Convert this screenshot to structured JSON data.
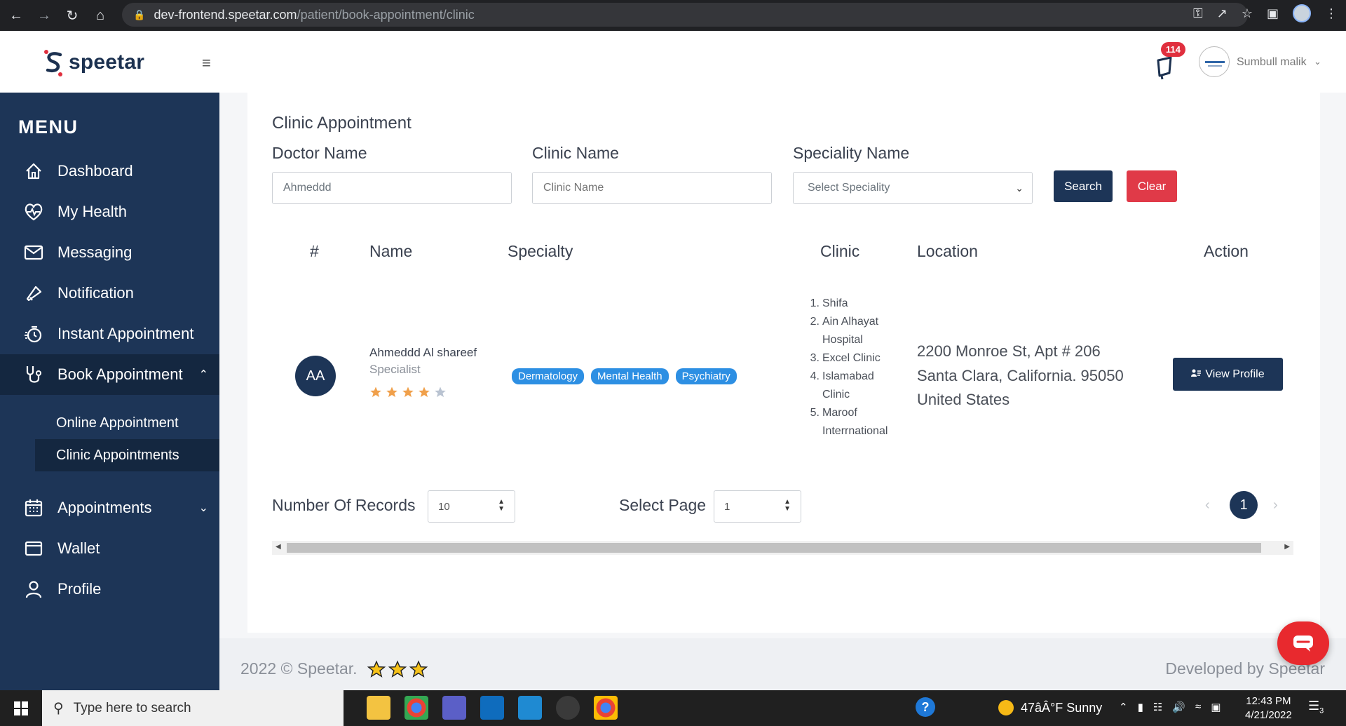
{
  "browser": {
    "url_host": "dev-frontend.speetar.com",
    "url_path": "/patient/book-appointment/clinic"
  },
  "header": {
    "logo_text": "speetar",
    "notification_count": "114",
    "user_name": "Sumbull malik"
  },
  "sidebar": {
    "menu_title": "MENU",
    "items": [
      {
        "label": "Dashboard",
        "icon": "home-icon"
      },
      {
        "label": "My Health",
        "icon": "heart-pulse-icon"
      },
      {
        "label": "Messaging",
        "icon": "envelope-icon"
      },
      {
        "label": "Notification",
        "icon": "megaphone-icon"
      },
      {
        "label": "Instant Appointment",
        "icon": "timer-icon"
      },
      {
        "label": "Book Appointment",
        "icon": "stethoscope-icon"
      },
      {
        "label": "Appointments",
        "icon": "calendar-icon"
      },
      {
        "label": "Wallet",
        "icon": "wallet-icon"
      },
      {
        "label": "Profile",
        "icon": "user-icon"
      }
    ],
    "sub_items": [
      {
        "label": "Online Appointment"
      },
      {
        "label": "Clinic Appointments"
      }
    ]
  },
  "filters": {
    "page_title": "Clinic Appointment",
    "doctor_label": "Doctor Name",
    "doctor_value": "Ahmeddd",
    "clinic_label": "Clinic Name",
    "clinic_placeholder": "Clinic Name",
    "speciality_label": "Speciality Name",
    "speciality_selected": "Select Speciality",
    "search_button": "Search",
    "clear_button": "Clear"
  },
  "table": {
    "headers": [
      "#",
      "Name",
      "Specialty",
      "Clinic",
      "Location",
      "Action"
    ],
    "rows": [
      {
        "initials": "AA",
        "name": "Ahmeddd Al shareef",
        "role": "Specialist",
        "rating": 4,
        "rating_max": 5,
        "specialties": [
          "Dermatology",
          "Mental Health",
          "Psychiatry"
        ],
        "clinics": [
          {
            "num": "1.",
            "lines": [
              "Shifa"
            ]
          },
          {
            "num": "2.",
            "lines": [
              "Ain Alhayat",
              "Hospital"
            ]
          },
          {
            "num": "3.",
            "lines": [
              "Excel Clinic"
            ]
          },
          {
            "num": "4.",
            "lines": [
              "Islamabad",
              "Clinic"
            ]
          },
          {
            "num": "5.",
            "lines": [
              "Maroof",
              "Interrnational"
            ]
          }
        ],
        "location": [
          "2200 Monroe St, Apt # 206",
          "Santa Clara, California. 95050",
          "United States"
        ],
        "action_label": "View Profile"
      }
    ]
  },
  "pagination": {
    "records_label": "Number Of Records",
    "records_value": "10",
    "page_label": "Select Page",
    "page_value": "1",
    "current_page": "1",
    "prev": "‹",
    "next": "›"
  },
  "footer": {
    "copyright": "2022 © Speetar.",
    "developed_by": "Developed by Speetar"
  },
  "taskbar": {
    "search_placeholder": "Type here to search",
    "weather": "47âÂ°F  Sunny",
    "time": "12:43 PM",
    "date": "4/21/2022",
    "notif_count": "3"
  },
  "colors": {
    "navy": "#1d3557",
    "red": "#e03a48",
    "tag_blue": "#2d8fe3",
    "star": "#f0a04b"
  }
}
